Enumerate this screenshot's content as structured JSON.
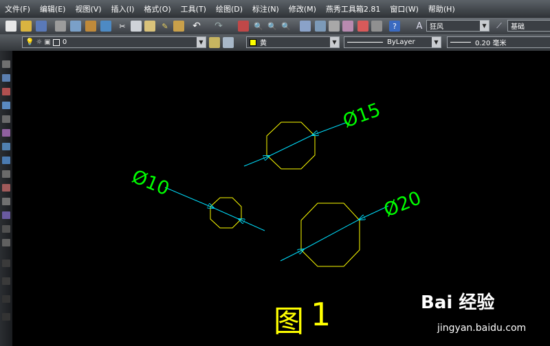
{
  "menu": [
    "文件(F)",
    "编辑(E)",
    "视图(V)",
    "插入(I)",
    "格式(O)",
    "工具(T)",
    "绘图(D)",
    "标注(N)",
    "修改(M)",
    "燕秀工具箱2.81",
    "窗口(W)",
    "帮助(H)"
  ],
  "toolbar": {
    "text_style": "狂风",
    "dim_style_partial": "基础",
    "layer_value": "0",
    "color_value": "黄",
    "linetype_value": "ByLayer",
    "lineweight_value": "0.20 毫米"
  },
  "drawing": {
    "dimensions": [
      {
        "label": "Ø15"
      },
      {
        "label": "Ø10"
      },
      {
        "label": "Ø20"
      }
    ],
    "caption_char": "图",
    "caption_num": "1",
    "colors": {
      "geometry": "#ffff00",
      "leader": "#00e0ff",
      "dim_text": "#00ff00"
    }
  },
  "watermark": {
    "logo_text": "Bai 经验",
    "url": "jingyan.baidu.com"
  }
}
